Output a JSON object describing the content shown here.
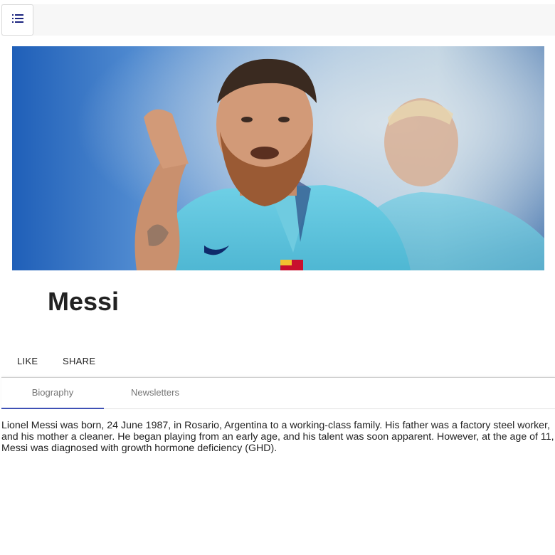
{
  "menu": {
    "icon": "list-icon"
  },
  "hero": {
    "alt": "Messi"
  },
  "profile": {
    "name": "Messi"
  },
  "actions": {
    "like_label": "LIKE",
    "share_label": "SHARE"
  },
  "tabs": [
    {
      "label": "Biography",
      "active": true
    },
    {
      "label": "Newsletters",
      "active": false
    }
  ],
  "biography": {
    "text": "Lionel Messi was born, 24 June 1987, in Rosario, Argentina to a working-class family. His father was a factory steel worker, and his mother a cleaner. He began playing from an early age, and his talent was soon apparent. However, at the age of 11, Messi was diagnosed with growth hormone deficiency (GHD)."
  },
  "colors": {
    "accent": "#3f51b5",
    "tab_inactive": "#757575",
    "text": "#222222"
  }
}
